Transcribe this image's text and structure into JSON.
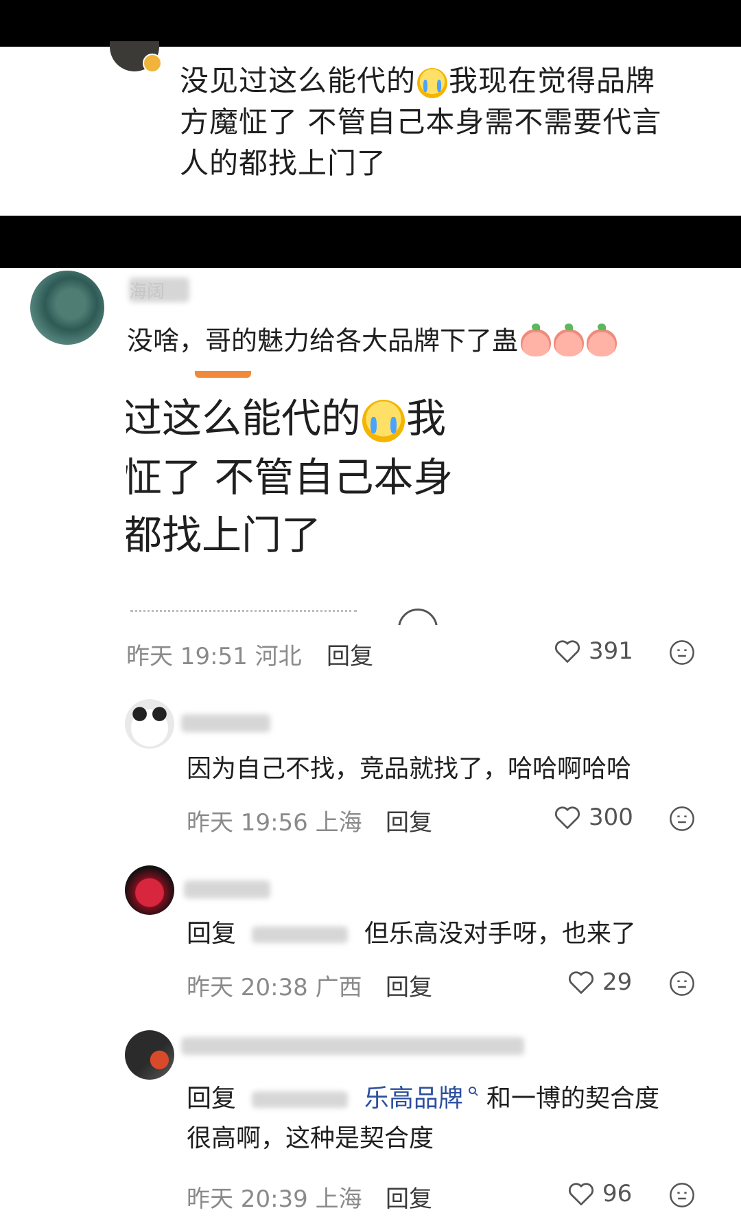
{
  "top_comment": {
    "line1a": "没见过这么能代的",
    "line1b": "我现在觉得品牌",
    "line2": "方魔怔了 不管自己本身需不需要代言",
    "line3": "人的都找上门了"
  },
  "main_comment": {
    "username": "海阔",
    "text": "没啥，哥的魅力给各大品牌下了蛊",
    "quoted_line1a": "过这么能代的",
    "quoted_line1b": "我",
    "quoted_line2": "怔了 不管自己本身",
    "quoted_line3": "都找上门了",
    "time": "昨天 19:51",
    "location": "河北",
    "reply_label": "回复",
    "likes": "391"
  },
  "replies": [
    {
      "text": "因为自己不找，竞品就找了，哈哈啊哈哈",
      "time": "昨天 19:56",
      "location": "上海",
      "reply_label": "回复",
      "likes": "300"
    },
    {
      "prefix": "回复",
      "text": "但乐高没对手呀，也来了",
      "time": "昨天 20:38",
      "location": "广西",
      "reply_label": "回复",
      "likes": "29"
    },
    {
      "prefix": "回复",
      "link": "乐高品牌",
      "text_after_link": "和一博的契合度",
      "text_line2": "很高啊，这种是契合度",
      "time": "昨天 20:39",
      "location": "上海",
      "reply_label": "回复",
      "likes": "96"
    }
  ],
  "icons": {
    "like": "heart-icon",
    "more": "face-icon",
    "search": "search-icon"
  },
  "colors": {
    "link": "#2b4f9e",
    "meta": "#8a8a8a"
  }
}
